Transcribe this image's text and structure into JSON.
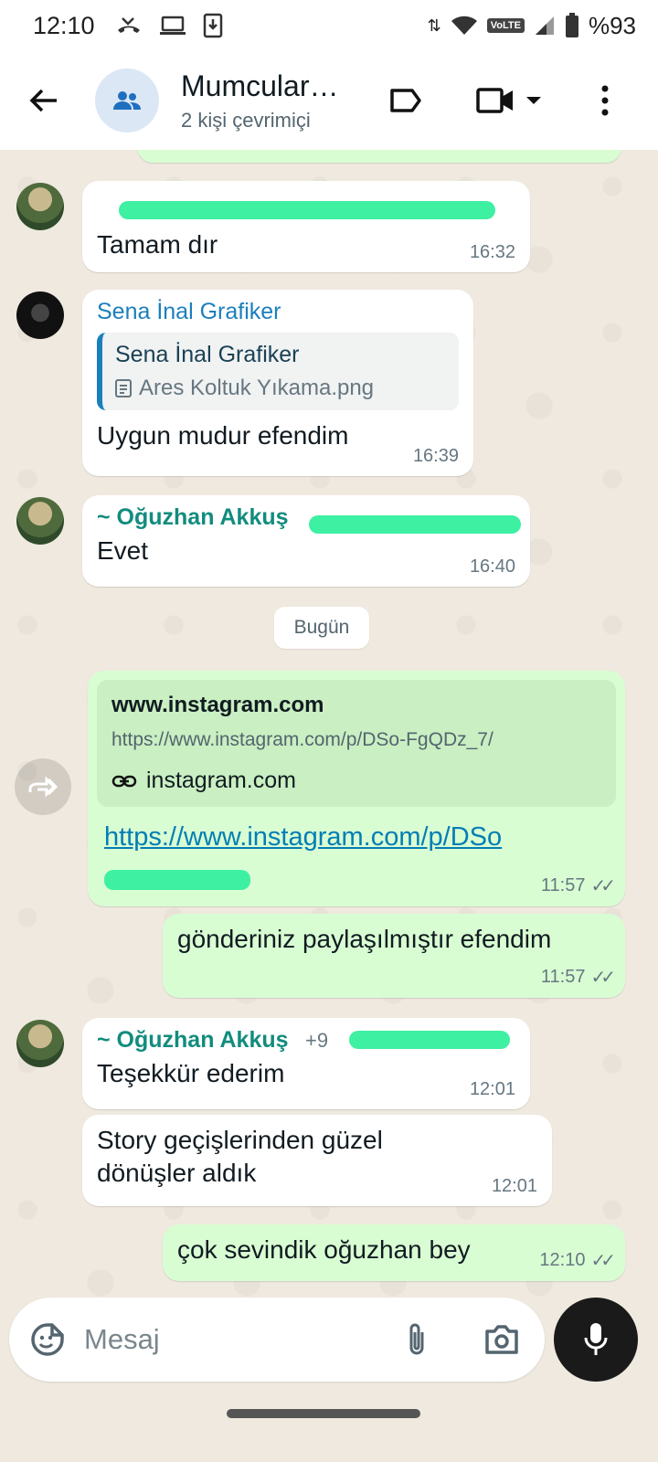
{
  "status_bar": {
    "time": "12:10",
    "network_label": "VoLTE",
    "battery": "%93"
  },
  "header": {
    "title": "Mumcular…",
    "subtitle": "2 kişi çevrimiçi"
  },
  "messages": [
    {
      "text": "Tamam dır",
      "time": "16:32"
    },
    {
      "sender": "Sena İnal Grafiker",
      "quote_name": "Sena İnal Grafiker",
      "quote_file": "Ares Koltuk Yıkama.png",
      "text": "Uygun mudur efendim",
      "time": "16:39"
    },
    {
      "sender": "~ Oğuzhan Akkuş",
      "text": "Evet",
      "time": "16:40"
    },
    {
      "preview_title": "www.instagram.com",
      "preview_url": "https://www.instagram.com/p/DSo-FgQDz_7/",
      "preview_domain": "instagram.com",
      "link_text": "https://www.instagram.com/p/DSo",
      "time": "11:57"
    },
    {
      "text": "gönderiniz paylaşılmıştır efendim",
      "time": "11:57"
    },
    {
      "sender": "~ Oğuzhan Akkuş",
      "sender_phone": "+9",
      "text": "Teşekkür ederim",
      "time": "12:01"
    },
    {
      "text": "Story geçişlerinden güzel dönüşler aldık",
      "time": "12:01"
    },
    {
      "text": "çok sevindik oğuzhan bey",
      "time": "12:10"
    }
  ],
  "date_divider": "Bugün",
  "composer": {
    "placeholder": "Mesaj"
  },
  "icons": {
    "back": "arrow-left-icon",
    "label": "label-icon",
    "video": "video-camera-icon",
    "menu": "more-vert-icon",
    "emoji": "sticker-icon",
    "attach": "paperclip-icon",
    "camera": "camera-icon",
    "mic": "mic-icon",
    "forward": "forward-icon"
  },
  "colors": {
    "outgoing_bubble": "#d9fdd3",
    "incoming_bubble": "#ffffff",
    "sender_green": "#128c7e",
    "link_blue": "#027eb5"
  }
}
